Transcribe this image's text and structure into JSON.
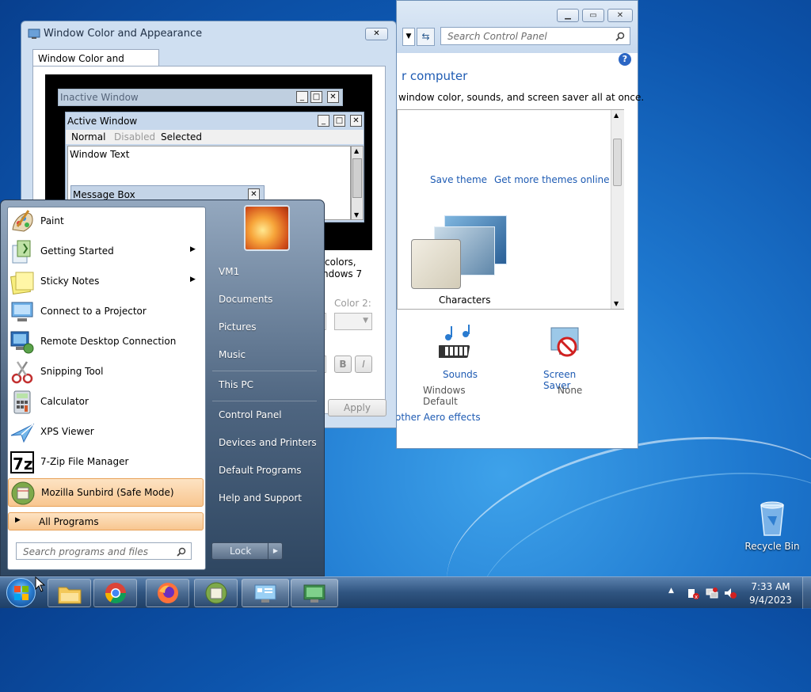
{
  "desktop": {
    "recycle_bin_label": "Recycle Bin"
  },
  "control_panel": {
    "search_placeholder": "Search Control Panel",
    "heading": "r computer",
    "subheading": "window color, sounds, and screen saver all at once.",
    "save_theme": "Save theme",
    "get_more_themes": "Get more themes online",
    "theme_name": "Characters",
    "sounds_label": "Sounds",
    "sounds_value": "Windows Default",
    "screensaver_label": "Screen Saver",
    "screensaver_value": "None",
    "aero_link": "other Aero effects"
  },
  "dialog": {
    "title": "Window Color and Appearance",
    "tab_label": "Window Color and Appearance",
    "inactive_window": "Inactive Window",
    "active_window": "Active Window",
    "menu_normal": "Normal",
    "menu_disabled": "Disabled",
    "menu_selected": "Selected",
    "window_text": "Window Text",
    "message_box": "Message Box",
    "desc_line1": "colors,",
    "desc_line2": "ndows 7",
    "color2_label": "Color 2:",
    "bold_label": "B",
    "italic_label": "I",
    "apply_label": "Apply"
  },
  "start_menu": {
    "programs": [
      {
        "label": "Paint",
        "icon": "paint-icon",
        "has_arrow": false
      },
      {
        "label": "Getting Started",
        "icon": "getting-started-icon",
        "has_arrow": true
      },
      {
        "label": "Sticky Notes",
        "icon": "sticky-notes-icon",
        "has_arrow": true
      },
      {
        "label": "Connect to a Projector",
        "icon": "projector-icon",
        "has_arrow": false
      },
      {
        "label": "Remote Desktop Connection",
        "icon": "remote-desktop-icon",
        "has_arrow": false
      },
      {
        "label": "Snipping Tool",
        "icon": "snipping-tool-icon",
        "has_arrow": false
      },
      {
        "label": "Calculator",
        "icon": "calculator-icon",
        "has_arrow": false
      },
      {
        "label": "XPS Viewer",
        "icon": "xps-viewer-icon",
        "has_arrow": false
      },
      {
        "label": "7-Zip File Manager",
        "icon": "seven-zip-icon",
        "has_arrow": false
      },
      {
        "label": "Mozilla Sunbird (Safe Mode)",
        "icon": "sunbird-icon",
        "has_arrow": false
      }
    ],
    "all_programs": "All Programs",
    "search_placeholder": "Search programs and files",
    "right_items": [
      "VM1",
      "Documents",
      "Pictures",
      "Music",
      "This PC",
      "Control Panel",
      "Devices and Printers",
      "Default Programs",
      "Help and Support"
    ],
    "lock_label": "Lock",
    "arrow_glyph": "▶"
  },
  "tray": {
    "time": "7:33 AM",
    "date": "9/4/2023"
  },
  "colors": {
    "accent": "#1e5bb3",
    "highlight": "#f8c690"
  }
}
